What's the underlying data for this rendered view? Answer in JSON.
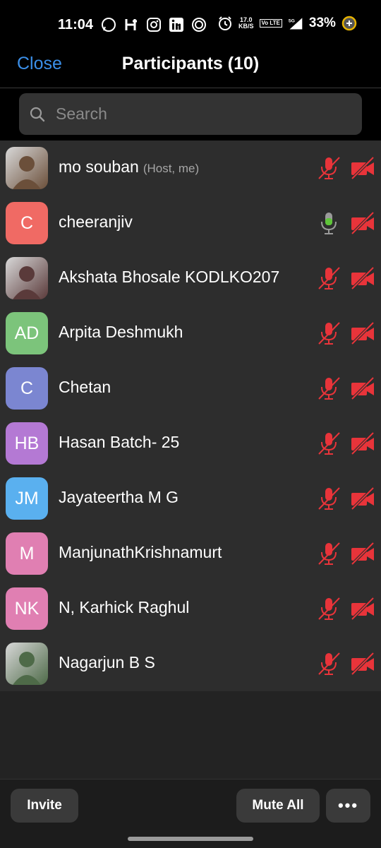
{
  "status_bar": {
    "time": "11:04",
    "speed_value": "17.0",
    "speed_unit": "KB/S",
    "network": "5G",
    "lte_label": "Vo LTE",
    "battery": "33%",
    "icons": [
      "whatsapp-icon",
      "h-app-icon",
      "instagram-icon",
      "linkedin-icon",
      "circle-app-icon"
    ]
  },
  "header": {
    "close_label": "Close",
    "title": "Participants (10)"
  },
  "search": {
    "placeholder": "Search"
  },
  "participants": [
    {
      "name": "mo souban",
      "tag": "(Host, me)",
      "initials": "",
      "avatar_type": "photo",
      "avatar_color": "#6b4f3a",
      "mic": "muted",
      "video": "off"
    },
    {
      "name": "cheeranjiv",
      "tag": "",
      "initials": "C",
      "avatar_type": "initials",
      "avatar_color": "#f06a64",
      "mic": "on",
      "video": "off"
    },
    {
      "name": "Akshata Bhosale KODLKO207",
      "tag": "",
      "initials": "",
      "avatar_type": "photo",
      "avatar_color": "#5a3a3a",
      "mic": "muted",
      "video": "off"
    },
    {
      "name": "Arpita Deshmukh",
      "tag": "",
      "initials": "AD",
      "avatar_type": "initials",
      "avatar_color": "#7cc47b",
      "mic": "muted",
      "video": "off"
    },
    {
      "name": "Chetan",
      "tag": "",
      "initials": "C",
      "avatar_type": "initials",
      "avatar_color": "#7b86d1",
      "mic": "muted",
      "video": "off"
    },
    {
      "name": "Hasan Batch- 25",
      "tag": "",
      "initials": "HB",
      "avatar_type": "initials",
      "avatar_color": "#b479d4",
      "mic": "muted",
      "video": "off"
    },
    {
      "name": "Jayateertha M G",
      "tag": "",
      "initials": "JM",
      "avatar_type": "initials",
      "avatar_color": "#5ab0ef",
      "mic": "muted",
      "video": "off"
    },
    {
      "name": "ManjunathKrishnamurt",
      "tag": "",
      "initials": "M",
      "avatar_type": "initials",
      "avatar_color": "#e07fb2",
      "mic": "muted",
      "video": "off"
    },
    {
      "name": "N, Karhick Raghul",
      "tag": "",
      "initials": "NK",
      "avatar_type": "initials",
      "avatar_color": "#e07fb2",
      "mic": "muted",
      "video": "off"
    },
    {
      "name": "Nagarjun B S",
      "tag": "",
      "initials": "",
      "avatar_type": "photo",
      "avatar_color": "#4e6a48",
      "mic": "muted",
      "video": "off"
    }
  ],
  "footer": {
    "invite_label": "Invite",
    "mute_all_label": "Mute All",
    "more_label": "•••"
  },
  "colors": {
    "accent": "#3b8fe8",
    "muted_red": "#e8343a",
    "mic_on_green": "#5fc43a"
  }
}
